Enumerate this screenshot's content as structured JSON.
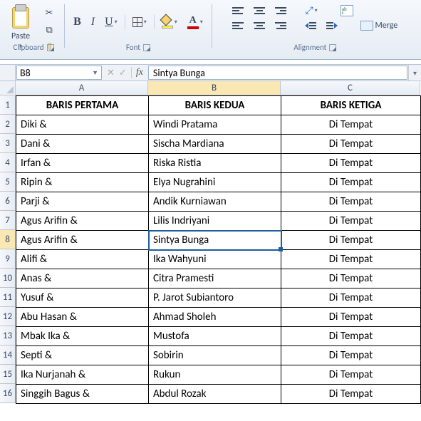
{
  "ribbon": {
    "paste_label": "Paste",
    "clipboard_title": "Clipboard",
    "font_title": "Font",
    "alignment_title": "Alignment",
    "merge_label": "Merge",
    "bold": "B",
    "italic": "I",
    "underline": "U",
    "fontcolor_letter": "A"
  },
  "namebox": {
    "value": "B8"
  },
  "formula": {
    "fx": "fx",
    "value": "Sintya Bunga"
  },
  "columns": [
    "A",
    "B",
    "C"
  ],
  "headers": {
    "a": "BARIS PERTAMA",
    "b": "BARIS KEDUA",
    "c": "BARIS KETIGA"
  },
  "rows": [
    {
      "n": "2",
      "a": "Diki &",
      "b": "Windi Pratama",
      "c": "Di Tempat"
    },
    {
      "n": "3",
      "a": "Dani &",
      "b": "Sischa Mardiana",
      "c": "Di Tempat"
    },
    {
      "n": "4",
      "a": "Irfan &",
      "b": "Riska Ristia",
      "c": "Di Tempat"
    },
    {
      "n": "5",
      "a": "Ripin &",
      "b": "Elya Nugrahini",
      "c": "Di Tempat"
    },
    {
      "n": "6",
      "a": "Parji &",
      "b": "Andik Kurniawan",
      "c": "Di Tempat"
    },
    {
      "n": "7",
      "a": "Agus Arifin &",
      "b": "Lilis Indriyani",
      "c": "Di Tempat"
    },
    {
      "n": "8",
      "a": "Agus Arifin &",
      "b": "Sintya Bunga",
      "c": "Di Tempat"
    },
    {
      "n": "9",
      "a": "Alifi &",
      "b": "Ika Wahyuni",
      "c": "Di Tempat"
    },
    {
      "n": "10",
      "a": "Anas &",
      "b": "Citra Pramesti",
      "c": "Di Tempat"
    },
    {
      "n": "11",
      "a": "Yusuf &",
      "b": "P. Jarot Subiantoro",
      "c": "Di Tempat"
    },
    {
      "n": "12",
      "a": "Abu Hasan &",
      "b": "Ahmad Sholeh",
      "c": "Di Tempat"
    },
    {
      "n": "13",
      "a": "Mbak Ika &",
      "b": "Mustofa",
      "c": "Di Tempat"
    },
    {
      "n": "14",
      "a": "Septi &",
      "b": "Sobirin",
      "c": "Di Tempat"
    },
    {
      "n": "15",
      "a": "Ika Nurjanah &",
      "b": "Rukun",
      "c": "Di Tempat"
    },
    {
      "n": "16",
      "a": "Singgih Bagus &",
      "b": "Abdul Rozak",
      "c": "Di Tempat"
    }
  ],
  "active": {
    "row": "8",
    "col": "B"
  }
}
